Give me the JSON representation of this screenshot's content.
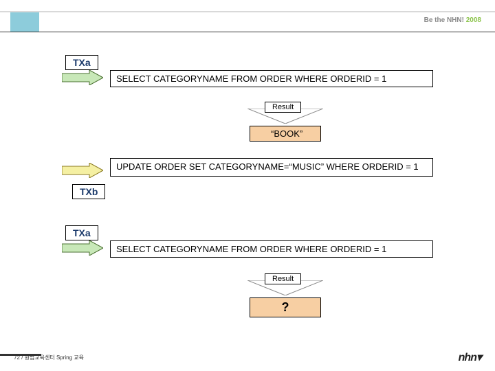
{
  "header": {
    "tag_prefix": "Be the NHN!",
    "tag_year": "2008"
  },
  "section1": {
    "tx": "TXa",
    "sql": "SELECT CATEGORYNAME FROM ORDER WHERE ORDERID = 1",
    "result_label": "Result",
    "result_value": "“BOOK”"
  },
  "section2": {
    "tx": "TXb",
    "sql": "UPDATE ORDER SET CATEGORYNAME=“MUSIC” WHERE ORDERID = 1"
  },
  "section3": {
    "tx": "TXa",
    "sql": "SELECT CATEGORYNAME FROM ORDER WHERE ORDERID = 1",
    "result_label": "Result",
    "result_value": "?"
  },
  "footer": {
    "text": "72 / 원범교육센터 Spring 교육",
    "logo": "nhn▾"
  }
}
